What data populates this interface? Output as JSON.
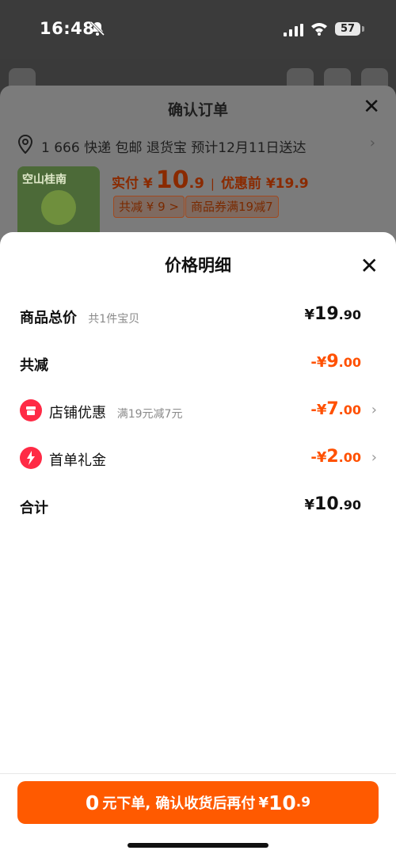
{
  "status": {
    "time": "16:48",
    "battery": "57"
  },
  "order": {
    "title": "确认订单",
    "address": "1 666 快递 包邮 退货宝 预计12月11日送达",
    "product_label": "空山桂南",
    "pay_label": "实付 ¥",
    "pay_int": "10",
    "pay_dec": ".9",
    "separator": "|",
    "before_label": "优惠前 ¥19.9",
    "tag_total": "共减 ¥ 9 >",
    "tag_coupon": "商品券满19减7"
  },
  "detail": {
    "title": "价格明细",
    "rows": [
      {
        "label": "商品总价",
        "sub": "共1件宝贝",
        "cur": "¥",
        "int": "19",
        "dec": ".90"
      },
      {
        "label": "共减",
        "cur": "-¥",
        "int": "9",
        "dec": ".00"
      },
      {
        "label": "店铺优惠",
        "sub": "满19元减7元",
        "cur": "-¥",
        "int": "7",
        "dec": ".00"
      },
      {
        "label": "首单礼金",
        "cur": "-¥",
        "int": "2",
        "dec": ".00"
      },
      {
        "label": "合计",
        "cur": "¥",
        "int": "10",
        "dec": ".90"
      }
    ]
  },
  "cta": {
    "zero": "0",
    "text": "元下单, 确认收货后再付",
    "cur": "¥",
    "int": "10",
    "dec": ".9"
  },
  "colors": {
    "accent": "#ff5000",
    "button": "#ff5a00",
    "icon_red": "#ff2a45"
  }
}
